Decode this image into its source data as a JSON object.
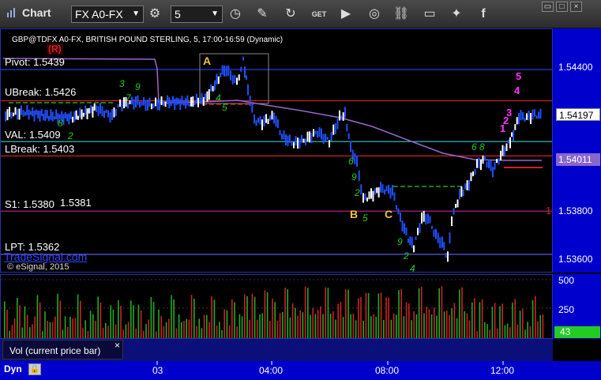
{
  "toolbar": {
    "title": "Chart",
    "symbol": "FX A0-FX",
    "interval": "5"
  },
  "chart": {
    "header": "GBP@TDFX A0-FX, BRITISH POUND STERLING, 5, 17:00-16:59 (Dynamic)",
    "copyright": "© eSignal, 2015",
    "watermark": "TradeSignal.com",
    "r_badge": "(R)",
    "levels": [
      {
        "label": "Pivot: 1.5439",
        "value": 1.5439,
        "color": "#2f3fff"
      },
      {
        "label": "UBreak: 1.5426",
        "value": 1.5426,
        "color": "#cc2222"
      },
      {
        "label": "VAL: 1.5409",
        "value": 1.5409,
        "color": "#33cccc"
      },
      {
        "label": "LBreak: 1.5403",
        "value": 1.5403,
        "color": "#cc2222"
      },
      {
        "label": "S1: 1.5380",
        "value": 1.538,
        "color": "#aa2288"
      },
      {
        "label": "LPT: 1.5362",
        "value": 1.5362,
        "color": "#6666ff"
      }
    ],
    "extra_label": "1.5381",
    "annotations": [
      "A",
      "B",
      "C"
    ],
    "right_marker": "1",
    "tick_numbers_green": [
      "3",
      "7",
      "9",
      "8",
      "2",
      "4",
      "5",
      "6",
      "9",
      "2",
      "5",
      "9",
      "2",
      "4",
      "6",
      "8"
    ],
    "tick_numbers_magenta": [
      "5",
      "4",
      "3",
      "2",
      "1"
    ]
  },
  "price_axis": {
    "ticks": [
      "1.54400",
      "1.54197",
      "1.54011",
      "1.53800",
      "1.53600"
    ],
    "current_price": "1.54197",
    "vwap_price": "1.54011"
  },
  "volume": {
    "legend": "Vol (current price bar)",
    "close_symbol": "×",
    "ticks": [
      "500",
      "250",
      "0"
    ],
    "current": "43"
  },
  "time_axis": {
    "mode": "Dyn",
    "labels": [
      "03",
      "04:00",
      "08:00",
      "12:00"
    ]
  },
  "colors": {
    "axis_bg": "#0000cc",
    "up_bar": "#ffffff",
    "down_bar": "#1f4fff",
    "vwap": "#9966cc",
    "vol_up": "#22aa22",
    "vol_down": "#cc2222"
  }
}
